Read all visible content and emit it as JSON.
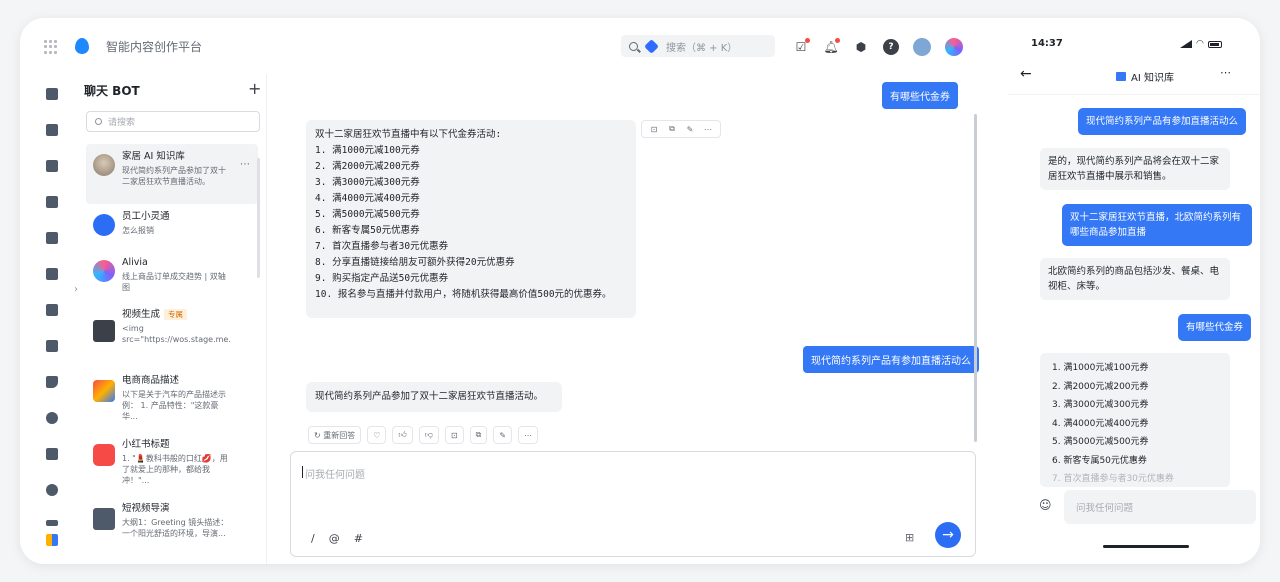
{
  "app": {
    "title": "智能内容创作平台"
  },
  "search": {
    "label": "搜索（⌘ + K）"
  },
  "top_icons": [
    "task-icon",
    "bell-icon",
    "settings-icon",
    "help-icon",
    "avatar-icon",
    "brand-icon"
  ],
  "sidebar": {
    "title": "聊天 BOT",
    "add_label": "+",
    "search_placeholder": "请搜索",
    "bots": [
      {
        "name": "家居 AI 知识库",
        "desc": "现代简约系列产品参加了双十二家居狂欢节直播活动。",
        "tag": "",
        "active": true
      },
      {
        "name": "员工小灵通",
        "desc": "怎么报销",
        "tag": ""
      },
      {
        "name": "Alivia",
        "desc": "线上商品订单成交趋势 | 双轴图",
        "tag": ""
      },
      {
        "name": "视频生成",
        "desc": "<img src=\"https://wos.stage.me..",
        "tag": "专属"
      },
      {
        "name": "电商商品描述",
        "desc": "以下是关于汽车的产品描述示例： 1. 产品特性：\"这款豪华...",
        "tag": ""
      },
      {
        "name": "小红书标题",
        "desc": "1. \"💄教科书般的口红💋，用了就爱上的那种，都给我冲！\"...",
        "tag": ""
      },
      {
        "name": "短视频导演",
        "desc": "大纲1：Greeting 镜头描述：一个阳光舒适的环境，导演...",
        "tag": ""
      }
    ]
  },
  "chat": {
    "q1": "有哪些代金券",
    "a1_intro": "双十二家居狂欢节直播中有以下代金券活动:",
    "a1_items": [
      "1. 满1000元减100元券",
      "2. 满2000元减200元券",
      "3. 满3000元减300元券",
      "4. 满4000元减400元券",
      "5. 满5000元减500元券",
      "6. 新客专属50元优惠券",
      "7. 首次直播参与者30元优惠券",
      "8. 分享直播链接给朋友可额外获得20元优惠券",
      "9. 购买指定产品送50元优惠券",
      "10. 报名参与直播并付款用户，将随机获得最高价值500元的优惠券。"
    ],
    "q2": "现代简约系列产品有参加直播活动么",
    "a2": "现代简约系列产品参加了双十二家居狂欢节直播活动。",
    "regenerate_label": "重新回答",
    "input_placeholder": "问我任何问题",
    "input_tools": [
      "/",
      "@",
      "#"
    ]
  },
  "mobile": {
    "time": "14:37",
    "title": "AI 知识库",
    "messages": [
      {
        "role": "user",
        "text": "现代简约系列产品有参加直播活动么"
      },
      {
        "role": "bot",
        "text": "是的，现代简约系列产品将会在双十二家居狂欢节直播中展示和销售。"
      },
      {
        "role": "user",
        "text": "双十二家居狂欢节直播，北欧简约系列有哪些商品参加直播"
      },
      {
        "role": "bot",
        "text": "北欧简约系列的商品包括沙发、餐桌、电视柜、床等。"
      },
      {
        "role": "user",
        "text": "有哪些代金券"
      }
    ],
    "list": [
      "1. 满1000元减100元券",
      "2. 满2000元减200元券",
      "3. 满3000元减300元券",
      "4. 满4000元减400元券",
      "5. 满5000元减500元券",
      "6. 新客专属50元优惠券",
      "7. 首次直播参与者30元优惠券"
    ],
    "input_placeholder": "问我任何问题"
  }
}
